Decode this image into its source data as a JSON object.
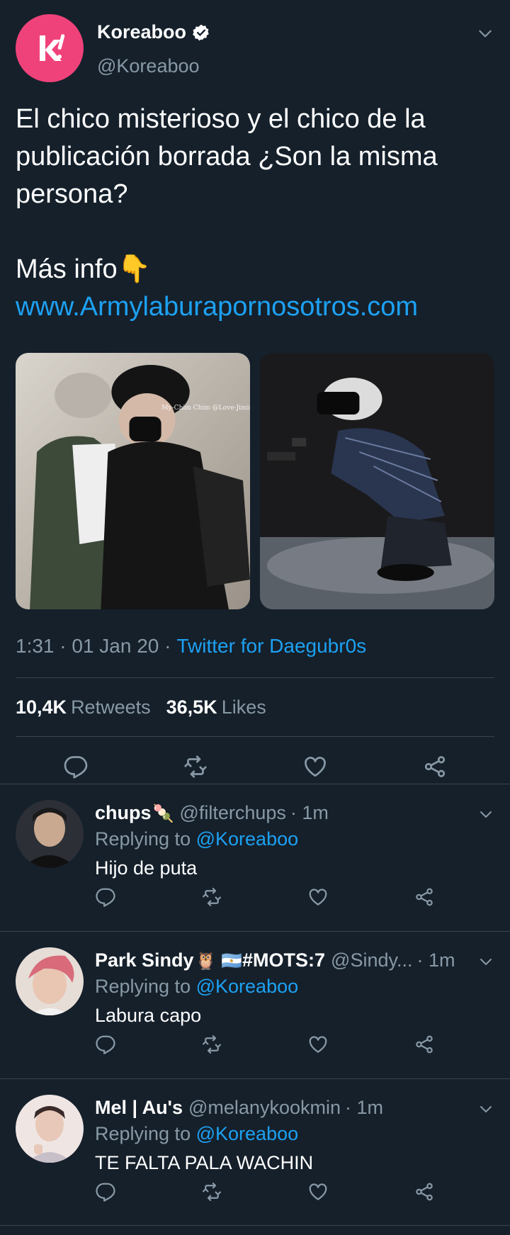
{
  "tweet": {
    "author_name": "Koreaboo",
    "author_handle": "@Koreaboo",
    "text": "El chico misterioso y el chico de la publicación borrada ¿Son la misma persona?\n\nMás info👇",
    "link": "www.Armylaburapornosotros.com",
    "image_watermark": "My-Chim Chim @Love-Jimin",
    "time": "1:31 · 01 Jan 20 ·",
    "source": "Twitter for Daegubr0s",
    "retweets_count": "10,4K",
    "retweets_label": "Retweets",
    "likes_count": "36,5K",
    "likes_label": "Likes"
  },
  "replies": [
    {
      "name": "chups",
      "name_emoji": "🍡",
      "handle": "@filterchups",
      "time": "· 1m",
      "replying_prefix": "Replying to",
      "replying_to": "@Koreaboo",
      "text": "Hijo de puta"
    },
    {
      "name": "Park Sindy",
      "name_emoji": "🦉 🇦🇷",
      "name_suffix": "#MOTS:7",
      "handle": "@Sindy...",
      "time": "· 1m",
      "replying_prefix": "Replying to",
      "replying_to": "@Koreaboo",
      "text": "Labura capo"
    },
    {
      "name": "Mel | Au's",
      "handle": "@melanykookmin",
      "time": "· 1m",
      "replying_prefix": "Replying to",
      "replying_to": "@Koreaboo",
      "text": "TE FALTA PALA WACHIN"
    }
  ],
  "icons": [
    "verified-icon",
    "chevron-down-icon",
    "reply-icon",
    "retweet-icon",
    "like-icon",
    "share-icon"
  ],
  "colors": {
    "background": "#15202b",
    "accent": "#1da1f2",
    "muted": "#8899a6",
    "brand": "#f0427a"
  }
}
